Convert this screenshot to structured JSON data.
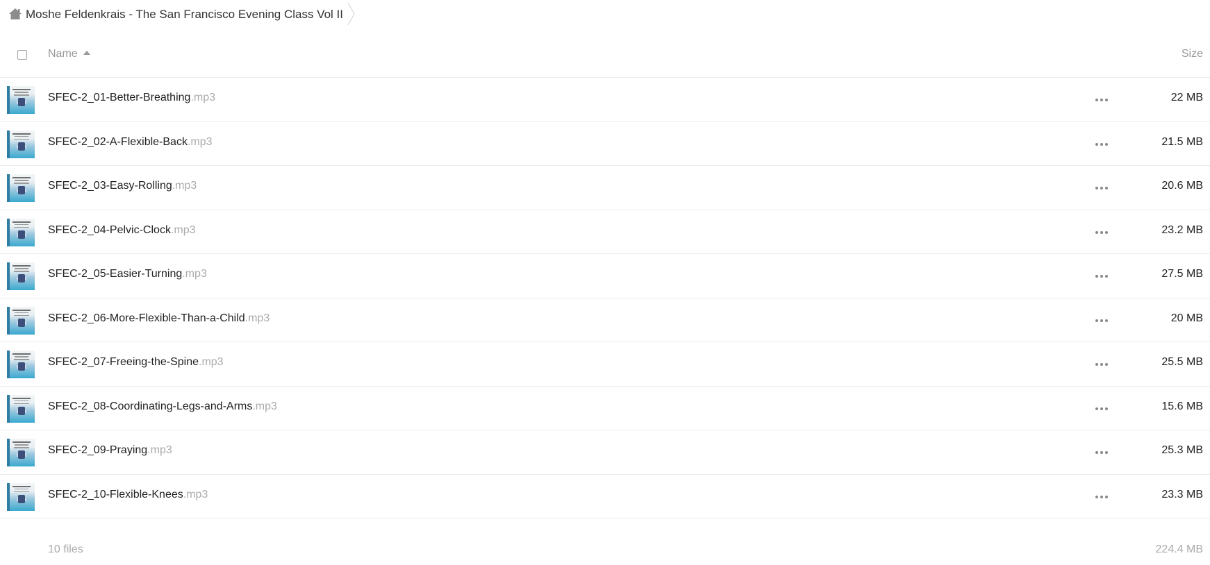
{
  "breadcrumb": {
    "home_icon": "home-icon",
    "folder": "Moshe Feldenkrais - The San Francisco Evening Class Vol II"
  },
  "header": {
    "name_label": "Name",
    "size_label": "Size",
    "sort_icon": "sort-ascending-icon"
  },
  "files": [
    {
      "base": "SFEC-2_01-Better-Breathing",
      "ext": ".mp3",
      "size": "22 MB"
    },
    {
      "base": "SFEC-2_02-A-Flexible-Back",
      "ext": ".mp3",
      "size": "21.5 MB"
    },
    {
      "base": "SFEC-2_03-Easy-Rolling",
      "ext": ".mp3",
      "size": "20.6 MB"
    },
    {
      "base": "SFEC-2_04-Pelvic-Clock",
      "ext": ".mp3",
      "size": "23.2 MB"
    },
    {
      "base": "SFEC-2_05-Easier-Turning",
      "ext": ".mp3",
      "size": "27.5 MB"
    },
    {
      "base": "SFEC-2_06-More-Flexible-Than-a-Child",
      "ext": ".mp3",
      "size": "20 MB"
    },
    {
      "base": "SFEC-2_07-Freeing-the-Spine",
      "ext": ".mp3",
      "size": "25.5 MB"
    },
    {
      "base": "SFEC-2_08-Coordinating-Legs-and-Arms",
      "ext": ".mp3",
      "size": "15.6 MB"
    },
    {
      "base": "SFEC-2_09-Praying",
      "ext": ".mp3",
      "size": "25.3 MB"
    },
    {
      "base": "SFEC-2_10-Flexible-Knees",
      "ext": ".mp3",
      "size": "23.3 MB"
    }
  ],
  "footer": {
    "count": "10 files",
    "total_size": "224.4 MB"
  }
}
